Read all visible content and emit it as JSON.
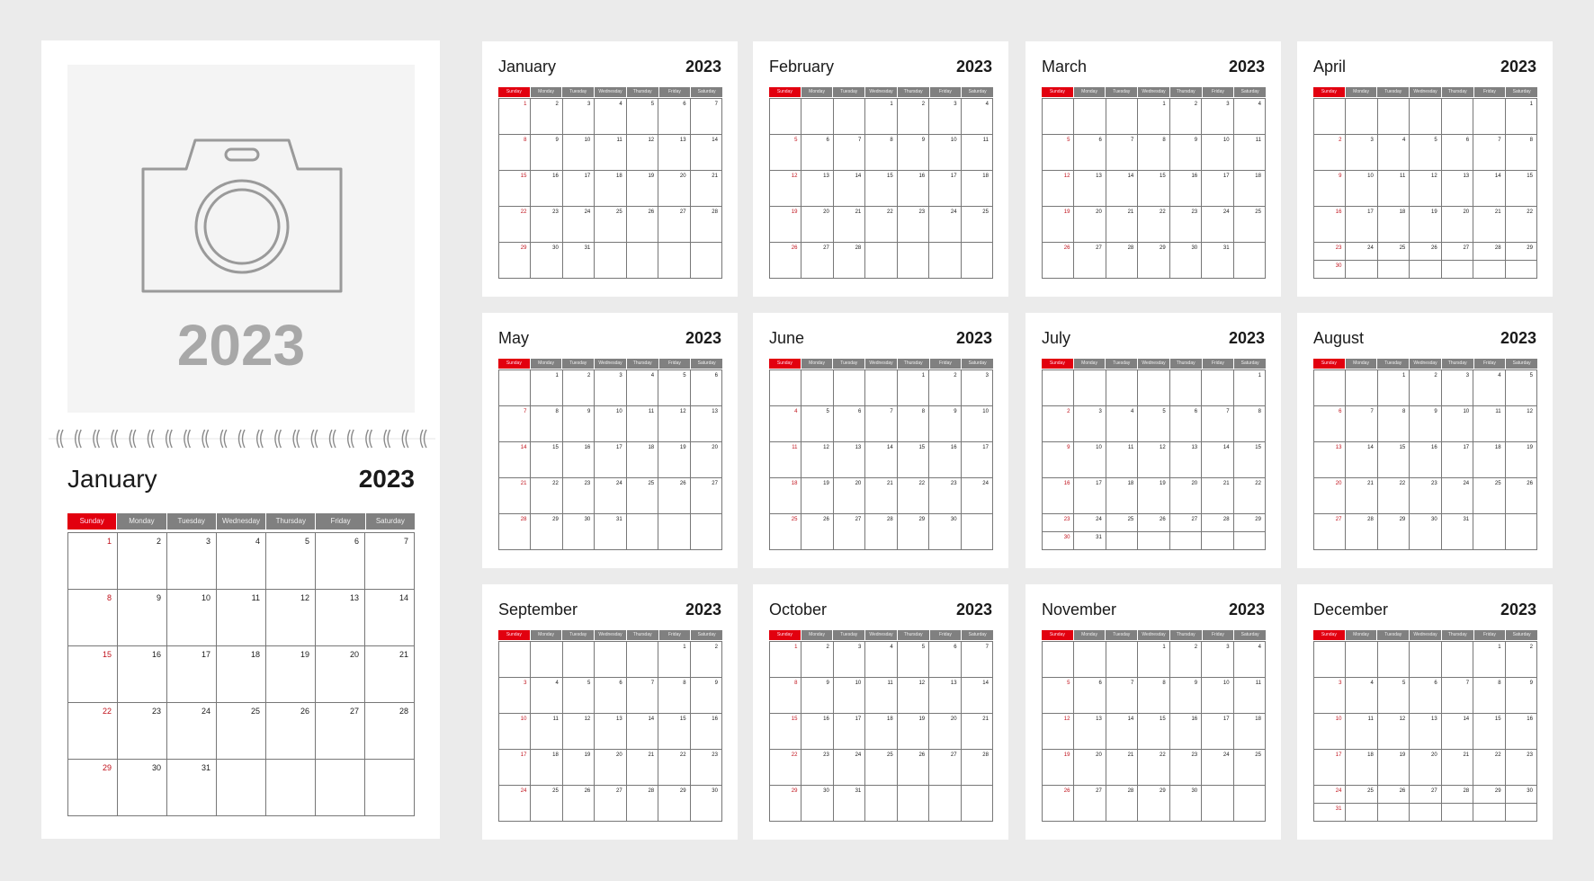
{
  "year": "2023",
  "weekdays": [
    "Sunday",
    "Monday",
    "Tuesday",
    "Wednesday",
    "Thursday",
    "Friday",
    "Saturday"
  ],
  "colors": {
    "background": "#ebebeb",
    "accent": "#e2000f",
    "header_gray": "#808080",
    "grid": "#777777",
    "photo_placeholder": "#f4f4f4"
  },
  "cover": {
    "icon": "camera-icon",
    "year": "2023",
    "month": "January",
    "year_label": "2023"
  },
  "months": [
    {
      "name": "January",
      "weeks": [
        [
          1,
          2,
          3,
          4,
          5,
          6,
          7
        ],
        [
          8,
          9,
          10,
          11,
          12,
          13,
          14
        ],
        [
          15,
          16,
          17,
          18,
          19,
          20,
          21
        ],
        [
          22,
          23,
          24,
          25,
          26,
          27,
          28
        ],
        [
          29,
          30,
          31,
          null,
          null,
          null,
          null
        ]
      ]
    },
    {
      "name": "February",
      "weeks": [
        [
          null,
          null,
          null,
          1,
          2,
          3,
          4
        ],
        [
          5,
          6,
          7,
          8,
          9,
          10,
          11
        ],
        [
          12,
          13,
          14,
          15,
          16,
          17,
          18
        ],
        [
          19,
          20,
          21,
          22,
          23,
          24,
          25
        ],
        [
          26,
          27,
          28,
          null,
          null,
          null,
          null
        ]
      ]
    },
    {
      "name": "March",
      "weeks": [
        [
          null,
          null,
          null,
          1,
          2,
          3,
          4
        ],
        [
          5,
          6,
          7,
          8,
          9,
          10,
          11
        ],
        [
          12,
          13,
          14,
          15,
          16,
          17,
          18
        ],
        [
          19,
          20,
          21,
          22,
          23,
          24,
          25
        ],
        [
          26,
          27,
          28,
          29,
          30,
          31,
          null
        ]
      ]
    },
    {
      "name": "April",
      "weeks": [
        [
          null,
          null,
          null,
          null,
          null,
          null,
          1
        ],
        [
          2,
          3,
          4,
          5,
          6,
          7,
          8
        ],
        [
          9,
          10,
          11,
          12,
          13,
          14,
          15
        ],
        [
          16,
          17,
          18,
          19,
          20,
          21,
          22
        ],
        [
          23,
          24,
          25,
          26,
          27,
          28,
          29
        ],
        [
          30,
          null,
          null,
          null,
          null,
          null,
          null
        ]
      ]
    },
    {
      "name": "May",
      "weeks": [
        [
          null,
          1,
          2,
          3,
          4,
          5,
          6
        ],
        [
          7,
          8,
          9,
          10,
          11,
          12,
          13
        ],
        [
          14,
          15,
          16,
          17,
          18,
          19,
          20
        ],
        [
          21,
          22,
          23,
          24,
          25,
          26,
          27
        ],
        [
          28,
          29,
          30,
          31,
          null,
          null,
          null
        ]
      ]
    },
    {
      "name": "June",
      "weeks": [
        [
          null,
          null,
          null,
          null,
          1,
          2,
          3
        ],
        [
          4,
          5,
          6,
          7,
          8,
          9,
          10
        ],
        [
          11,
          12,
          13,
          14,
          15,
          16,
          17
        ],
        [
          18,
          19,
          20,
          21,
          22,
          23,
          24
        ],
        [
          25,
          26,
          27,
          28,
          29,
          30,
          null
        ]
      ]
    },
    {
      "name": "July",
      "weeks": [
        [
          null,
          null,
          null,
          null,
          null,
          null,
          1
        ],
        [
          2,
          3,
          4,
          5,
          6,
          7,
          8
        ],
        [
          9,
          10,
          11,
          12,
          13,
          14,
          15
        ],
        [
          16,
          17,
          18,
          19,
          20,
          21,
          22
        ],
        [
          23,
          24,
          25,
          26,
          27,
          28,
          29
        ],
        [
          30,
          31,
          null,
          null,
          null,
          null,
          null
        ]
      ]
    },
    {
      "name": "August",
      "weeks": [
        [
          null,
          null,
          1,
          2,
          3,
          4,
          5
        ],
        [
          6,
          7,
          8,
          9,
          10,
          11,
          12
        ],
        [
          13,
          14,
          15,
          16,
          17,
          18,
          19
        ],
        [
          20,
          21,
          22,
          23,
          24,
          25,
          26
        ],
        [
          27,
          28,
          29,
          30,
          31,
          null,
          null
        ]
      ]
    },
    {
      "name": "September",
      "weeks": [
        [
          null,
          null,
          null,
          null,
          null,
          1,
          2
        ],
        [
          3,
          4,
          5,
          6,
          7,
          8,
          9
        ],
        [
          10,
          11,
          12,
          13,
          14,
          15,
          16
        ],
        [
          17,
          18,
          19,
          20,
          21,
          22,
          23
        ],
        [
          24,
          25,
          26,
          27,
          28,
          29,
          30
        ]
      ]
    },
    {
      "name": "October",
      "weeks": [
        [
          1,
          2,
          3,
          4,
          5,
          6,
          7
        ],
        [
          8,
          9,
          10,
          11,
          12,
          13,
          14
        ],
        [
          15,
          16,
          17,
          18,
          19,
          20,
          21
        ],
        [
          22,
          23,
          24,
          25,
          26,
          27,
          28
        ],
        [
          29,
          30,
          31,
          null,
          null,
          null,
          null
        ]
      ]
    },
    {
      "name": "November",
      "weeks": [
        [
          null,
          null,
          null,
          1,
          2,
          3,
          4
        ],
        [
          5,
          6,
          7,
          8,
          9,
          10,
          11
        ],
        [
          12,
          13,
          14,
          15,
          16,
          17,
          18
        ],
        [
          19,
          20,
          21,
          22,
          23,
          24,
          25
        ],
        [
          26,
          27,
          28,
          29,
          30,
          null,
          null
        ]
      ]
    },
    {
      "name": "December",
      "weeks": [
        [
          null,
          null,
          null,
          null,
          null,
          1,
          2
        ],
        [
          3,
          4,
          5,
          6,
          7,
          8,
          9
        ],
        [
          10,
          11,
          12,
          13,
          14,
          15,
          16
        ],
        [
          17,
          18,
          19,
          20,
          21,
          22,
          23
        ],
        [
          24,
          25,
          26,
          27,
          28,
          29,
          30
        ],
        [
          31,
          null,
          null,
          null,
          null,
          null,
          null
        ]
      ]
    }
  ]
}
